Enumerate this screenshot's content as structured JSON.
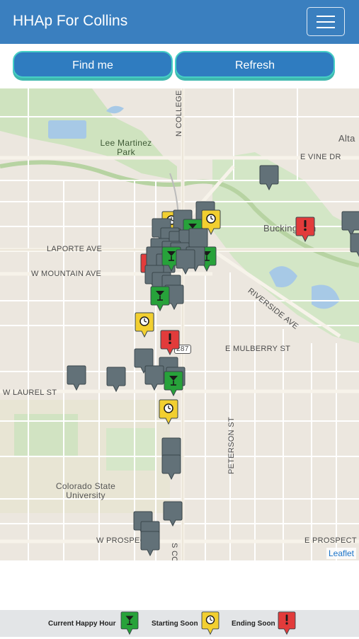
{
  "navbar": {
    "title": "HHAp For Collins"
  },
  "buttons": {
    "find_me": "Find me",
    "refresh": "Refresh"
  },
  "map": {
    "labels": {
      "lee_martinez_park": "Lee Martinez Park",
      "n_college": "N COLLEGE",
      "alta": "Alta",
      "e_vine_dr": "E VINE DR",
      "buckingham": "Buckingham",
      "laporte_ave": "LAPORTE AVE",
      "w_mountain_ave": "W MOUNTAIN AVE",
      "riverside_ave": "RIVERSIDE AVE",
      "e_mulberry_st": "E MULBERRY ST",
      "route_287": "287",
      "w_laurel_st": "W LAUREL ST",
      "peterson_st": "PETERSON ST",
      "colorado_state_university": "Colorado State University",
      "s_college_ave": "S COLLEGE AVE",
      "w_prospect": "W PROSPECT",
      "e_prospect": "E PROSPECT"
    },
    "attribution": "Leaflet"
  },
  "legend": {
    "current": "Current Happy Hour",
    "starting": "Starting Soon",
    "ending": "Ending Soon"
  },
  "colors": {
    "navbar": "#3a7fbf",
    "button": "#2f7cc0",
    "button_border": "#46cfc5",
    "marker_gray": "#627178",
    "marker_green": "#27a23a",
    "marker_yellow": "#f2cf30",
    "marker_red": "#e23b3b"
  }
}
